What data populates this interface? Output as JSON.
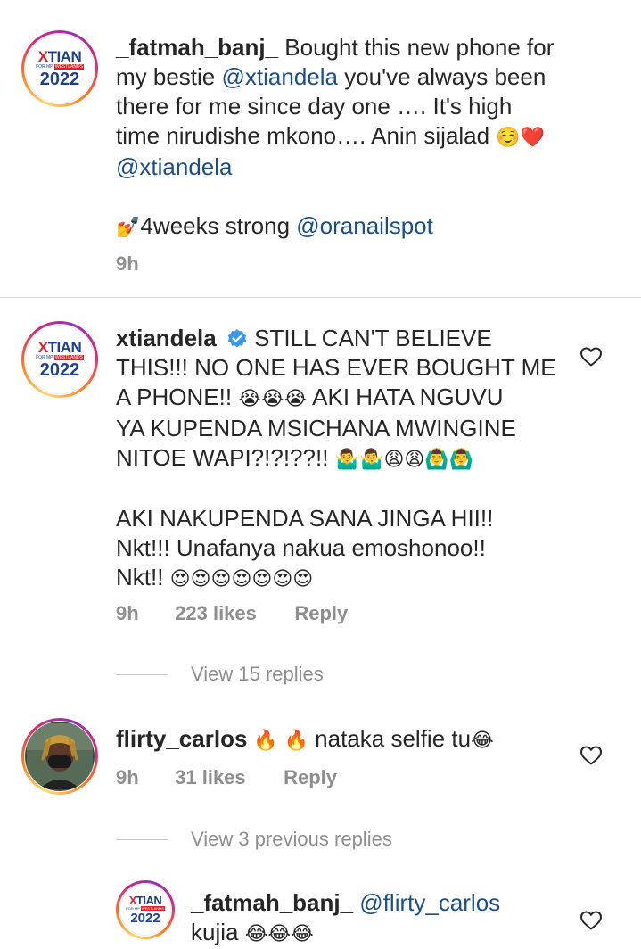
{
  "caption": {
    "username": "_fatmah_banj_",
    "text_1": " Bought this new phone for",
    "text_2": "my bestie ",
    "mention_1": "@xtiandela",
    "text_3": " you've always been",
    "text_4": "there for me since day one …. It's high",
    "text_5": "time nirudishe mkono…. Anin sijalad ",
    "emoji_1": "☺️❤️",
    "mention_2": "@xtiandela",
    "emoji_nail": "💅",
    "text_6": "4weeks strong  ",
    "mention_3": "@oranailspot",
    "time": "9h"
  },
  "comment1": {
    "username": "xtiandela",
    "line_1": " STILL CAN'T BELIEVE",
    "line_2": "THIS!!! NO ONE HAS EVER BOUGHT ME",
    "line_3": "A PHONE!! ",
    "emoji_1": "😭😭😭",
    "line_3b": " AKI HATA NGUVU",
    "line_4": "YA KUPENDA MSICHANA MWINGINE",
    "line_5": "NITOE WAPI?!?!??!! ",
    "emoji_2": "🤷‍♂️🤷‍♂️😩😩🙆‍♂️🙆‍♂️",
    "line_6": "AKI NAKUPENDA SANA JINGA HII!!",
    "line_7": "Nkt!!! Unafanya nakua emoshonoo!!",
    "line_8": "Nkt!! ",
    "emoji_3": "😍😍😍😍😍😍😍",
    "time": "9h",
    "likes": "223 likes",
    "reply": "Reply",
    "view_replies": "View 15 replies"
  },
  "comment2": {
    "username": "flirty_carlos",
    "emoji_1": " 🔥 🔥 ",
    "text": "nataka selfie tu",
    "emoji_2": "😂",
    "time": "9h",
    "likes": "31 likes",
    "reply": "Reply",
    "view_replies": "View 3 previous replies"
  },
  "reply1": {
    "username": "_fatmah_banj_",
    "mention": " @flirty_carlos",
    "text": "kujia ",
    "emoji": "😂😂😂"
  },
  "logo": {
    "brand_a": "X",
    "brand_b": "TIAN",
    "strip_a": "FOR MP ",
    "strip_b": "WESTLANDS",
    "year": "2022"
  },
  "icons": {
    "heart": "heart-icon",
    "verified": "verified-badge-icon"
  },
  "colors": {
    "link": "#1a4f8c",
    "verified": "#3897f0",
    "muted": "#8e8e8e"
  }
}
